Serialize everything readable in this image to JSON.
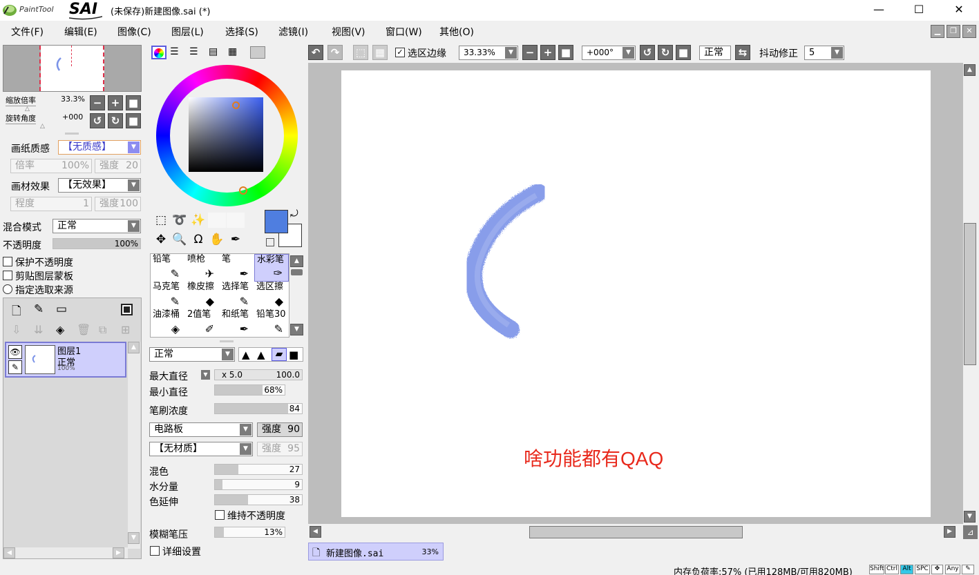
{
  "app": {
    "logo_small": "PaintTool",
    "logo_big": "SAI",
    "title": "(未保存)新建图像.sai (*)"
  },
  "window_controls": {
    "minimize": "—",
    "maximize": "☐",
    "close": "✕"
  },
  "menu": [
    "文件(F)",
    "编辑(E)",
    "图像(C)",
    "图层(L)",
    "选择(S)",
    "滤镜(I)",
    "视图(V)",
    "窗口(W)",
    "其他(O)"
  ],
  "navigator": {
    "zoom_label": "缩放倍率",
    "zoom_value": "33.3%",
    "rotate_label": "旋转角度",
    "rotate_value": "+000"
  },
  "paper": {
    "texture_label": "画纸质感",
    "texture_value": "【无质感】",
    "scale_label": "倍率",
    "scale_value": "100%",
    "strength_label": "强度",
    "strength_value": "20",
    "effect_label": "画材效果",
    "effect_value": "【无效果】",
    "degree_label": "程度",
    "degree_value": "1",
    "strength2_label": "强度",
    "strength2_value": "100"
  },
  "layer_props": {
    "blend_label": "混合模式",
    "blend_value": "正常",
    "opacity_label": "不透明度",
    "opacity_value": "100%",
    "opacity_fill": 1.0,
    "protect": "保护不透明度",
    "clip": "剪贴图层蒙板",
    "source": "指定选取来源"
  },
  "layer": {
    "name": "图层1",
    "mode": "正常",
    "opacity": "100%"
  },
  "tools": [
    {
      "label": "铅笔",
      "icon": "✎"
    },
    {
      "label": "喷枪",
      "icon": "✈"
    },
    {
      "label": "笔",
      "icon": "✒"
    },
    {
      "label": "水彩笔",
      "icon": "✑"
    },
    {
      "label": "马克笔",
      "icon": "✎"
    },
    {
      "label": "橡皮擦",
      "icon": "◆"
    },
    {
      "label": "选择笔",
      "icon": "✎"
    },
    {
      "label": "选区擦",
      "icon": "◆"
    },
    {
      "label": "油漆桶",
      "icon": "◈"
    },
    {
      "label": "2值笔",
      "icon": "✐"
    },
    {
      "label": "和纸笔",
      "icon": "✒"
    },
    {
      "label": "铅笔30",
      "icon": "✎"
    }
  ],
  "brush": {
    "mode_value": "正常",
    "max_label": "最大直径",
    "max_mult": "x 5.0",
    "max_value": "100.0",
    "min_label": "最小直径",
    "min_value": "68%",
    "min_fill": 0.68,
    "density_label": "笔刷浓度",
    "density_value": "84",
    "density_fill": 0.84,
    "texture_value": "电路板",
    "texture_strength_label": "强度",
    "texture_strength_value": "90",
    "material_value": "【无材质】",
    "material_strength_label": "强度",
    "material_strength_value": "95",
    "blend_label": "混色",
    "blend_value": "27",
    "blend_fill": 0.27,
    "water_label": "水分量",
    "water_value": "9",
    "water_fill": 0.09,
    "stretch_label": "色延伸",
    "stretch_value": "38",
    "stretch_fill": 0.38,
    "keep_opacity_label": "维持不透明度",
    "blur_label": "模糊笔压",
    "blur_value": "13%",
    "blur_fill": 0.13,
    "detail_label": "详细设置"
  },
  "toolbar": {
    "selection_edge": "选区边缘",
    "zoom": "33.33%",
    "rotation": "+000°",
    "mode": "正常",
    "stabilizer_label": "抖动修正",
    "stabilizer_value": "5"
  },
  "canvas": {
    "annotation": "啥功能都有QAQ",
    "annotation_color": "#e8291c",
    "stroke_color": "#7b93e8"
  },
  "doc_tab": {
    "name": "新建图像.sai",
    "zoom": "33%"
  },
  "status": {
    "memory": "内存负荷率:57% (已用128MB/可用820MB)",
    "keys": [
      "Shift",
      "Ctrl",
      "Alt",
      "SPC",
      "✥",
      "Any",
      "✎"
    ]
  },
  "colors": {
    "primary": "#4f7ee0",
    "secondary": "#ffffff",
    "selection": "#cfcffc"
  }
}
